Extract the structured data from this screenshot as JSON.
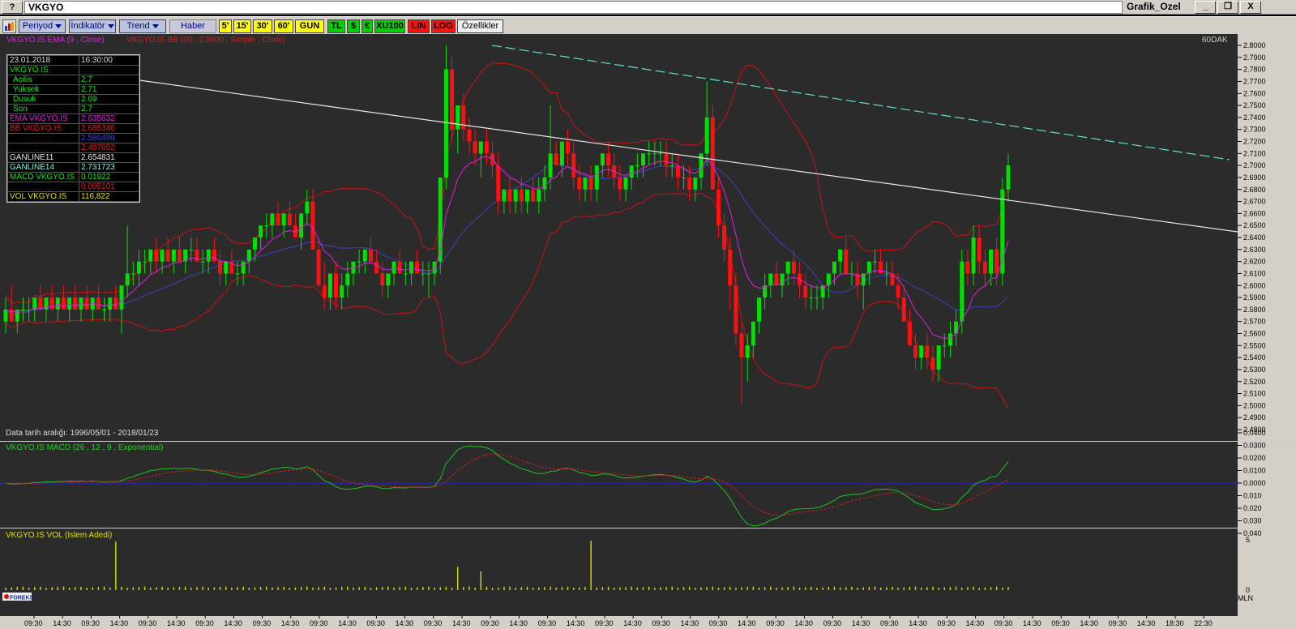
{
  "window": {
    "symbol": "VKGYO",
    "title": "Grafik_Ozel",
    "help_label": "?",
    "min_label": "_",
    "max_label": "❐",
    "close_label": "X"
  },
  "toolbar": {
    "periyod": "Periyod",
    "indikator": "İndikatör",
    "trend": "Trend",
    "haber": "Haber",
    "p5": "5'",
    "p15": "15'",
    "p30": "30'",
    "p60": "60'",
    "gun": "GUN",
    "tl": "TL",
    "usd": "$",
    "eur": "€",
    "xu100": "XU100",
    "lin": "LIN",
    "log": "LOG",
    "ozellikler": "Özellikler"
  },
  "colors": {
    "up": "#00e000",
    "down": "#ff1010",
    "ema": "#e020e0",
    "bb": "#d01010",
    "mid": "#4040c0",
    "trend_white": "#e8e8e8",
    "trend_cyan": "#60e0d0",
    "macd": "#20c020",
    "signal": "#d02020",
    "volume": "#e0e000"
  },
  "price_panel": {
    "caption_ema": "VKGYO.IS EMA (9 , Close)",
    "caption_bb": "VKGYO.IS BB (20 , 2.0000 , Simple , Close)",
    "period_label": "60DAK",
    "data_range": "Data tarih aralığı: 1996/05/01 - 2018/01/23"
  },
  "infobox": {
    "date": "23.01.2018",
    "time": "16:30:00",
    "symbol": "VKGYO.IS",
    "rows": [
      {
        "k": "Acilis",
        "v": "2.7"
      },
      {
        "k": "Yuksek",
        "v": "2.71"
      },
      {
        "k": "Dusuk",
        "v": "2.69"
      },
      {
        "k": "Son",
        "v": "2.7"
      }
    ],
    "ema_label": "EMA VKGYO.IS",
    "ema_value": "2.635632",
    "bb_label": "BB VKGYO.IS",
    "bb_upper": "2.685346",
    "bb_mid": "2.586499",
    "bb_lower": "2.487652",
    "gl11_label": "GANLINE11",
    "gl11_value": "2.654831",
    "gl14_label": "GANLINE14",
    "gl14_value": "2.731723",
    "macd_label": "MACD VKGYO.IS",
    "macd_value": "0.01922",
    "macd_signal": "0.005101",
    "vol_label": "VOL VKGYO.IS",
    "vol_value": "116,822"
  },
  "macd_panel": {
    "caption": "VKGYO.IS MACD (26 , 12 , 9 , Exponential)",
    "ticks": [
      "0.0400",
      "0.0300",
      "0.0200",
      "0.0100",
      "0.0000",
      "0.010",
      "0.020",
      "0.030",
      "0.040"
    ]
  },
  "vol_panel": {
    "caption": "VKGYO.IS VOL (Islem Adedi)",
    "tick_top": "5",
    "tick_bottom": "0",
    "unit": "MLN",
    "logo": "FOREKS"
  },
  "time_axis": [
    "09:30",
    "14:30",
    "09:30",
    "14:30",
    "09:30",
    "14:30",
    "09:30",
    "14:30",
    "09:30",
    "14:30",
    "09:30",
    "14:30",
    "09:30",
    "14:30",
    "09:30",
    "14:30",
    "09:30",
    "14:30",
    "09:30",
    "14:30",
    "09:30",
    "14:30",
    "09:30",
    "14:30",
    "09:30",
    "14:30",
    "09:30",
    "14:30",
    "09:30",
    "14:30",
    "09:30",
    "14:30",
    "09:30",
    "14:30",
    "09:30",
    "14:30",
    "09:30",
    "14:30",
    "09:30",
    "14:30",
    "18:30",
    "22:30"
  ],
  "chart_data": {
    "type": "candlestick",
    "price_axis": [
      "2.8000",
      "2.7900",
      "2.7800",
      "2.7700",
      "2.7600",
      "2.7500",
      "2.7400",
      "2.7300",
      "2.7200",
      "2.7100",
      "2.7000",
      "2.6900",
      "2.6800",
      "2.6700",
      "2.6600",
      "2.6500",
      "2.6400",
      "2.6300",
      "2.6200",
      "2.6100",
      "2.6000",
      "2.5900",
      "2.5800",
      "2.5700",
      "2.5600",
      "2.5500",
      "2.5400",
      "2.5300",
      "2.5200",
      "2.5100",
      "2.5000",
      "2.4900",
      "2.4800"
    ],
    "ylim": [
      2.48,
      2.8
    ],
    "candles": [
      [
        2.57,
        2.59,
        2.56,
        2.58
      ],
      [
        2.58,
        2.6,
        2.57,
        2.57
      ],
      [
        2.57,
        2.58,
        2.56,
        2.58
      ],
      [
        2.58,
        2.59,
        2.57,
        2.58
      ],
      [
        2.58,
        2.59,
        2.57,
        2.58
      ],
      [
        2.58,
        2.59,
        2.57,
        2.59
      ],
      [
        2.59,
        2.6,
        2.58,
        2.58
      ],
      [
        2.58,
        2.59,
        2.57,
        2.59
      ],
      [
        2.59,
        2.6,
        2.58,
        2.58
      ],
      [
        2.58,
        2.59,
        2.57,
        2.59
      ],
      [
        2.59,
        2.6,
        2.58,
        2.58
      ],
      [
        2.58,
        2.59,
        2.57,
        2.59
      ],
      [
        2.59,
        2.6,
        2.58,
        2.58
      ],
      [
        2.58,
        2.59,
        2.57,
        2.59
      ],
      [
        2.59,
        2.6,
        2.58,
        2.58
      ],
      [
        2.58,
        2.59,
        2.57,
        2.59
      ],
      [
        2.59,
        2.6,
        2.58,
        2.58
      ],
      [
        2.58,
        2.59,
        2.57,
        2.58
      ],
      [
        2.58,
        2.59,
        2.57,
        2.59
      ],
      [
        2.59,
        2.6,
        2.58,
        2.58
      ],
      [
        2.58,
        2.6,
        2.56,
        2.6
      ],
      [
        2.6,
        2.65,
        2.59,
        2.61
      ],
      [
        2.61,
        2.62,
        2.6,
        2.61
      ],
      [
        2.61,
        2.63,
        2.6,
        2.62
      ],
      [
        2.62,
        2.63,
        2.61,
        2.62
      ],
      [
        2.62,
        2.63,
        2.61,
        2.63
      ],
      [
        2.63,
        2.64,
        2.61,
        2.62
      ],
      [
        2.62,
        2.63,
        2.61,
        2.63
      ],
      [
        2.63,
        2.64,
        2.62,
        2.62
      ],
      [
        2.62,
        2.63,
        2.61,
        2.63
      ],
      [
        2.63,
        2.64,
        2.62,
        2.62
      ],
      [
        2.62,
        2.63,
        2.61,
        2.63
      ],
      [
        2.63,
        2.64,
        2.62,
        2.63
      ],
      [
        2.63,
        2.64,
        2.62,
        2.62
      ],
      [
        2.62,
        2.63,
        2.61,
        2.62
      ],
      [
        2.62,
        2.63,
        2.61,
        2.63
      ],
      [
        2.63,
        2.64,
        2.62,
        2.62
      ],
      [
        2.62,
        2.63,
        2.6,
        2.61
      ],
      [
        2.61,
        2.62,
        2.6,
        2.62
      ],
      [
        2.62,
        2.63,
        2.61,
        2.61
      ],
      [
        2.61,
        2.62,
        2.6,
        2.61
      ],
      [
        2.61,
        2.62,
        2.6,
        2.62
      ],
      [
        2.62,
        2.63,
        2.61,
        2.63
      ],
      [
        2.63,
        2.64,
        2.62,
        2.64
      ],
      [
        2.64,
        2.65,
        2.63,
        2.65
      ],
      [
        2.65,
        2.66,
        2.64,
        2.65
      ],
      [
        2.65,
        2.66,
        2.64,
        2.66
      ],
      [
        2.66,
        2.67,
        2.65,
        2.65
      ],
      [
        2.65,
        2.66,
        2.64,
        2.66
      ],
      [
        2.66,
        2.67,
        2.65,
        2.65
      ],
      [
        2.65,
        2.66,
        2.64,
        2.64
      ],
      [
        2.64,
        2.66,
        2.63,
        2.66
      ],
      [
        2.66,
        2.68,
        2.65,
        2.67
      ],
      [
        2.67,
        2.68,
        2.65,
        2.63
      ],
      [
        2.63,
        2.64,
        2.6,
        2.6
      ],
      [
        2.6,
        2.62,
        2.58,
        2.59
      ],
      [
        2.59,
        2.61,
        2.58,
        2.61
      ],
      [
        2.61,
        2.62,
        2.58,
        2.59
      ],
      [
        2.59,
        2.61,
        2.58,
        2.6
      ],
      [
        2.6,
        2.62,
        2.59,
        2.61
      ],
      [
        2.61,
        2.62,
        2.6,
        2.62
      ],
      [
        2.62,
        2.63,
        2.61,
        2.62
      ],
      [
        2.62,
        2.63,
        2.61,
        2.63
      ],
      [
        2.63,
        2.64,
        2.62,
        2.62
      ],
      [
        2.62,
        2.63,
        2.61,
        2.61
      ],
      [
        2.61,
        2.62,
        2.59,
        2.6
      ],
      [
        2.6,
        2.61,
        2.59,
        2.61
      ],
      [
        2.61,
        2.62,
        2.6,
        2.62
      ],
      [
        2.62,
        2.63,
        2.61,
        2.61
      ],
      [
        2.61,
        2.62,
        2.6,
        2.61
      ],
      [
        2.61,
        2.62,
        2.6,
        2.62
      ],
      [
        2.62,
        2.63,
        2.61,
        2.61
      ],
      [
        2.61,
        2.62,
        2.6,
        2.61
      ],
      [
        2.61,
        2.62,
        2.59,
        2.61
      ],
      [
        2.61,
        2.62,
        2.6,
        2.62
      ],
      [
        2.62,
        2.68,
        2.61,
        2.69
      ],
      [
        2.69,
        2.8,
        2.68,
        2.78
      ],
      [
        2.78,
        2.79,
        2.72,
        2.73
      ],
      [
        2.73,
        2.75,
        2.71,
        2.75
      ],
      [
        2.75,
        2.76,
        2.72,
        2.73
      ],
      [
        2.73,
        2.74,
        2.71,
        2.72
      ],
      [
        2.72,
        2.73,
        2.7,
        2.71
      ],
      [
        2.71,
        2.72,
        2.69,
        2.72
      ],
      [
        2.72,
        2.73,
        2.7,
        2.71
      ],
      [
        2.71,
        2.72,
        2.69,
        2.7
      ],
      [
        2.7,
        2.71,
        2.66,
        2.67
      ],
      [
        2.67,
        2.68,
        2.66,
        2.68
      ],
      [
        2.68,
        2.69,
        2.66,
        2.67
      ],
      [
        2.67,
        2.68,
        2.66,
        2.68
      ],
      [
        2.68,
        2.69,
        2.66,
        2.67
      ],
      [
        2.67,
        2.68,
        2.66,
        2.68
      ],
      [
        2.68,
        2.69,
        2.67,
        2.67
      ],
      [
        2.67,
        2.69,
        2.66,
        2.68
      ],
      [
        2.68,
        2.7,
        2.67,
        2.69
      ],
      [
        2.69,
        2.75,
        2.68,
        2.71
      ],
      [
        2.71,
        2.72,
        2.7,
        2.7
      ],
      [
        2.7,
        2.72,
        2.69,
        2.72
      ],
      [
        2.72,
        2.73,
        2.7,
        2.71
      ],
      [
        2.71,
        2.72,
        2.68,
        2.69
      ],
      [
        2.69,
        2.7,
        2.67,
        2.68
      ],
      [
        2.68,
        2.69,
        2.67,
        2.69
      ],
      [
        2.69,
        2.7,
        2.67,
        2.68
      ],
      [
        2.68,
        2.7,
        2.67,
        2.7
      ],
      [
        2.7,
        2.71,
        2.69,
        2.71
      ],
      [
        2.71,
        2.72,
        2.69,
        2.7
      ],
      [
        2.7,
        2.71,
        2.68,
        2.69
      ],
      [
        2.69,
        2.7,
        2.67,
        2.68
      ],
      [
        2.68,
        2.69,
        2.67,
        2.69
      ],
      [
        2.69,
        2.7,
        2.68,
        2.7
      ],
      [
        2.7,
        2.71,
        2.69,
        2.7
      ],
      [
        2.7,
        2.71,
        2.69,
        2.71
      ],
      [
        2.71,
        2.72,
        2.7,
        2.71
      ],
      [
        2.71,
        2.72,
        2.7,
        2.71
      ],
      [
        2.71,
        2.72,
        2.7,
        2.71
      ],
      [
        2.71,
        2.72,
        2.69,
        2.7
      ],
      [
        2.7,
        2.71,
        2.69,
        2.7
      ],
      [
        2.7,
        2.71,
        2.68,
        2.69
      ],
      [
        2.69,
        2.7,
        2.68,
        2.69
      ],
      [
        2.69,
        2.7,
        2.67,
        2.68
      ],
      [
        2.68,
        2.69,
        2.67,
        2.69
      ],
      [
        2.69,
        2.71,
        2.68,
        2.71
      ],
      [
        2.71,
        2.77,
        2.7,
        2.74
      ],
      [
        2.74,
        2.75,
        2.68,
        2.68
      ],
      [
        2.68,
        2.69,
        2.64,
        2.65
      ],
      [
        2.65,
        2.66,
        2.62,
        2.63
      ],
      [
        2.63,
        2.64,
        2.58,
        2.6
      ],
      [
        2.6,
        2.61,
        2.55,
        2.56
      ],
      [
        2.56,
        2.57,
        2.5,
        2.54
      ],
      [
        2.54,
        2.56,
        2.52,
        2.55
      ],
      [
        2.55,
        2.57,
        2.54,
        2.57
      ],
      [
        2.57,
        2.59,
        2.56,
        2.59
      ],
      [
        2.59,
        2.61,
        2.58,
        2.6
      ],
      [
        2.6,
        2.61,
        2.59,
        2.61
      ],
      [
        2.61,
        2.62,
        2.6,
        2.6
      ],
      [
        2.6,
        2.61,
        2.59,
        2.61
      ],
      [
        2.61,
        2.62,
        2.6,
        2.62
      ],
      [
        2.62,
        2.63,
        2.6,
        2.61
      ],
      [
        2.61,
        2.62,
        2.59,
        2.6
      ],
      [
        2.6,
        2.61,
        2.58,
        2.59
      ],
      [
        2.59,
        2.6,
        2.58,
        2.59
      ],
      [
        2.59,
        2.6,
        2.58,
        2.59
      ],
      [
        2.59,
        2.6,
        2.58,
        2.6
      ],
      [
        2.6,
        2.61,
        2.59,
        2.61
      ],
      [
        2.61,
        2.62,
        2.6,
        2.62
      ],
      [
        2.62,
        2.63,
        2.61,
        2.63
      ],
      [
        2.63,
        2.64,
        2.61,
        2.61
      ],
      [
        2.61,
        2.62,
        2.6,
        2.61
      ],
      [
        2.61,
        2.62,
        2.59,
        2.6
      ],
      [
        2.6,
        2.61,
        2.58,
        2.61
      ],
      [
        2.61,
        2.62,
        2.6,
        2.62
      ],
      [
        2.62,
        2.63,
        2.61,
        2.62
      ],
      [
        2.62,
        2.63,
        2.61,
        2.61
      ],
      [
        2.61,
        2.62,
        2.6,
        2.61
      ],
      [
        2.61,
        2.62,
        2.6,
        2.6
      ],
      [
        2.6,
        2.61,
        2.58,
        2.59
      ],
      [
        2.59,
        2.6,
        2.57,
        2.57
      ],
      [
        2.57,
        2.58,
        2.55,
        2.55
      ],
      [
        2.55,
        2.56,
        2.53,
        2.54
      ],
      [
        2.54,
        2.55,
        2.53,
        2.55
      ],
      [
        2.55,
        2.56,
        2.53,
        2.54
      ],
      [
        2.54,
        2.55,
        2.52,
        2.53
      ],
      [
        2.53,
        2.55,
        2.52,
        2.55
      ],
      [
        2.55,
        2.56,
        2.54,
        2.55
      ],
      [
        2.55,
        2.57,
        2.54,
        2.56
      ],
      [
        2.56,
        2.58,
        2.55,
        2.57
      ],
      [
        2.57,
        2.63,
        2.56,
        2.62
      ],
      [
        2.62,
        2.63,
        2.6,
        2.61
      ],
      [
        2.61,
        2.65,
        2.6,
        2.64
      ],
      [
        2.64,
        2.65,
        2.61,
        2.62
      ],
      [
        2.62,
        2.63,
        2.6,
        2.61
      ],
      [
        2.61,
        2.63,
        2.6,
        2.63
      ],
      [
        2.63,
        2.64,
        2.6,
        2.61
      ],
      [
        2.61,
        2.69,
        2.6,
        2.68
      ],
      [
        2.68,
        2.71,
        2.67,
        2.7
      ]
    ],
    "ema_approx_points": [
      [
        0,
        2.578
      ],
      [
        20,
        2.583
      ],
      [
        30,
        2.612
      ],
      [
        45,
        2.637
      ],
      [
        53,
        2.655
      ],
      [
        60,
        2.617
      ],
      [
        75,
        2.616
      ],
      [
        82,
        2.708
      ],
      [
        95,
        2.69
      ],
      [
        110,
        2.703
      ],
      [
        118,
        2.7
      ],
      [
        125,
        2.707
      ],
      [
        132,
        2.612
      ],
      [
        140,
        2.596
      ],
      [
        150,
        2.604
      ],
      [
        165,
        2.6
      ],
      [
        172,
        2.552
      ],
      [
        180,
        2.56
      ],
      [
        190,
        2.595
      ],
      [
        195,
        2.636
      ]
    ],
    "macd_approx_points": [
      [
        0,
        0.0
      ],
      [
        35,
        0.012
      ],
      [
        50,
        0.015
      ],
      [
        60,
        0.002
      ],
      [
        76,
        0.002
      ],
      [
        85,
        0.03
      ],
      [
        98,
        0.009
      ],
      [
        125,
        0.003
      ],
      [
        132,
        -0.022
      ],
      [
        140,
        -0.03
      ],
      [
        160,
        -0.009
      ],
      [
        177,
        -0.022
      ],
      [
        195,
        0.019
      ]
    ],
    "volume_spikes": [
      [
        19,
        5.2
      ],
      [
        78,
        2.5
      ],
      [
        82,
        2.0
      ],
      [
        101,
        5.3
      ],
      [
        193,
        1.6
      ]
    ]
  }
}
